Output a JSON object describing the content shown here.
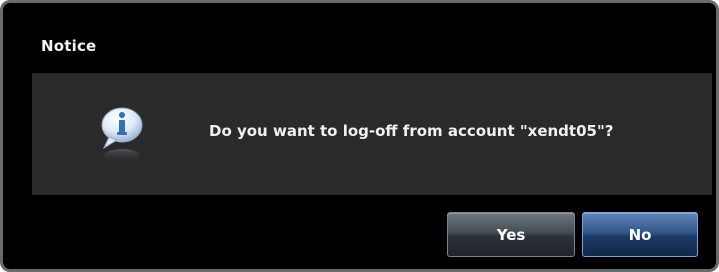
{
  "dialog": {
    "title": "Notice",
    "message": "Do you want to log-off from account \"xendt05\"?",
    "icon": "info-speech-bubble-icon"
  },
  "buttons": {
    "yes_label": "Yes",
    "no_label": "No"
  },
  "colors": {
    "background": "#000000",
    "content_panel": "#2a2a2a",
    "border": "#6a6a6a",
    "yes_button": "#454d54",
    "no_button": "#33578a",
    "icon_blue": "#2f6fc0"
  }
}
